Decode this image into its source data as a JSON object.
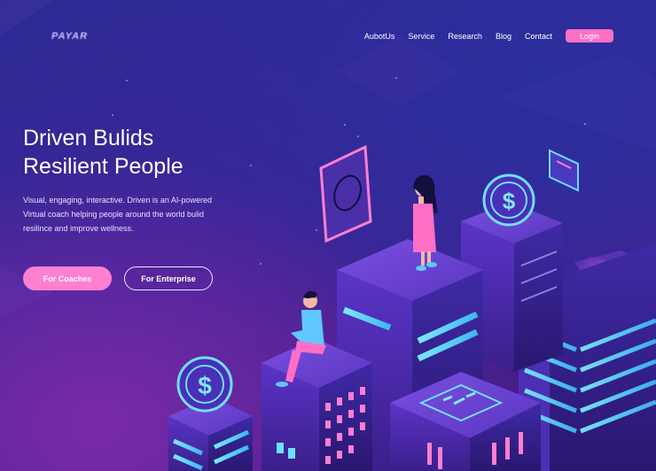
{
  "brand": {
    "logo_text": "PAYAR"
  },
  "nav": {
    "links": [
      "AubotUs",
      "Service",
      "Research",
      "Blog",
      "Contact"
    ],
    "login_label": "Login"
  },
  "hero": {
    "headline_line1": "Driven Bulids",
    "headline_line2": "Resilient People",
    "description": "Visual, engaging, interactive. Driven is an AI-powered Virtual coach helping people around the world bulid resilince and improve wellness.",
    "primary_cta": "For Coaches",
    "secondary_cta": "For Enterprise"
  },
  "illustration": {
    "icons": [
      "dollar-coin-icon",
      "dollar-coin-icon",
      "document-card-icon",
      "phone-card-icon"
    ],
    "figures": [
      "woman-figure",
      "man-figure"
    ]
  },
  "colors": {
    "background": "#3a2597",
    "accent_pink": "#ff6fc6",
    "accent_cyan": "#5fe0ff",
    "building_purple": "#4b2aa8"
  }
}
